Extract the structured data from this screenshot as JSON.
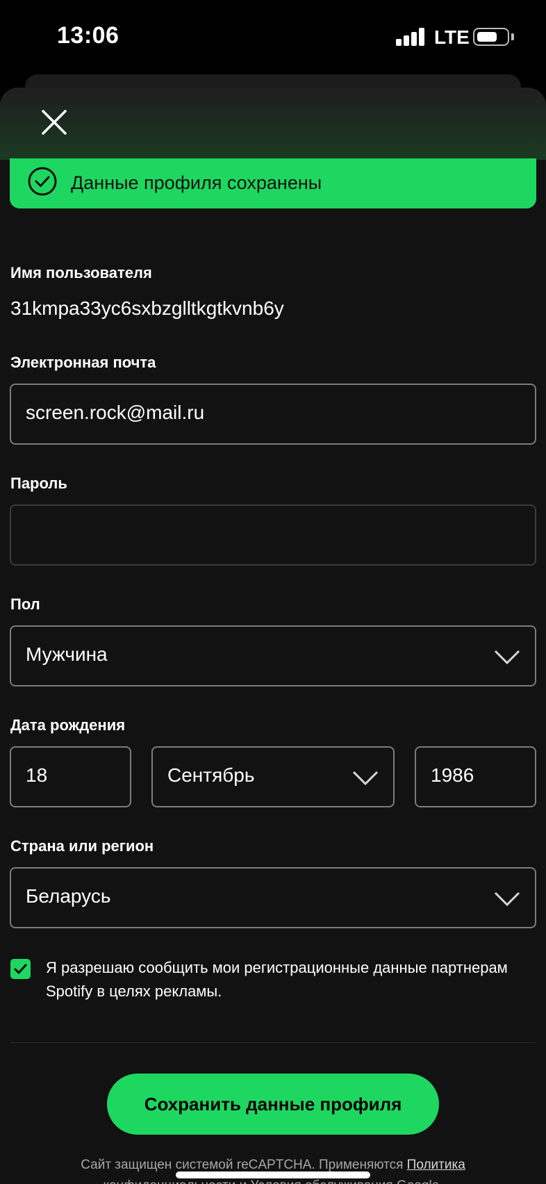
{
  "status_bar": {
    "time": "13:06",
    "network": "LTE"
  },
  "toast": {
    "message": "Данные профиля сохранены"
  },
  "form": {
    "username": {
      "label": "Имя пользователя",
      "value": "31kmpa33yc6sxbzglltkgtkvnb6y"
    },
    "email": {
      "label": "Электронная почта",
      "value": "screen.rock@mail.ru"
    },
    "password": {
      "label": "Пароль",
      "value": ""
    },
    "gender": {
      "label": "Пол",
      "value": "Мужчина"
    },
    "birth_date": {
      "label": "Дата рождения",
      "day": "18",
      "month": "Сентябрь",
      "year": "1986"
    },
    "country": {
      "label": "Страна или регион",
      "value": "Беларусь"
    },
    "consent": {
      "checked": true,
      "text": "Я разрешаю сообщить мои регистрационные данные партнерам Spotify в целях рекламы."
    }
  },
  "save_button": {
    "label": "Сохранить данные профиля"
  },
  "recaptcha": {
    "prefix": "Сайт защищен системой reCAPTCHA. Применяются ",
    "link": "Политика",
    "line2": "конфиденциальности и Условия обслуживания Google."
  },
  "colors": {
    "accent": "#1ed760",
    "background": "#121212"
  }
}
